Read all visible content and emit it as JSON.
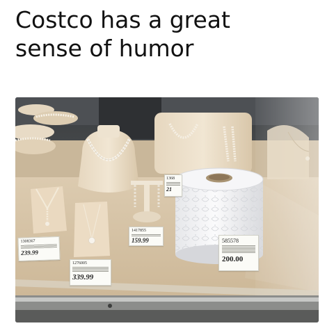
{
  "caption": {
    "line1": "Costco has a great",
    "line2": "sense of humor"
  },
  "photo": {
    "subject": "toilet-paper-roll-in-jewelry-case",
    "tags": {
      "tag_left_small": {
        "code": "1308367",
        "price": "239.99"
      },
      "tag_pendant": {
        "code": "1276005",
        "price": "339.99"
      },
      "tag_earrings": {
        "code": "1417855",
        "price": "159.99"
      },
      "tag_back": {
        "code": "1368",
        "price": "21"
      },
      "tag_toilet_paper": {
        "code": "585578",
        "price": "200.00"
      }
    }
  }
}
